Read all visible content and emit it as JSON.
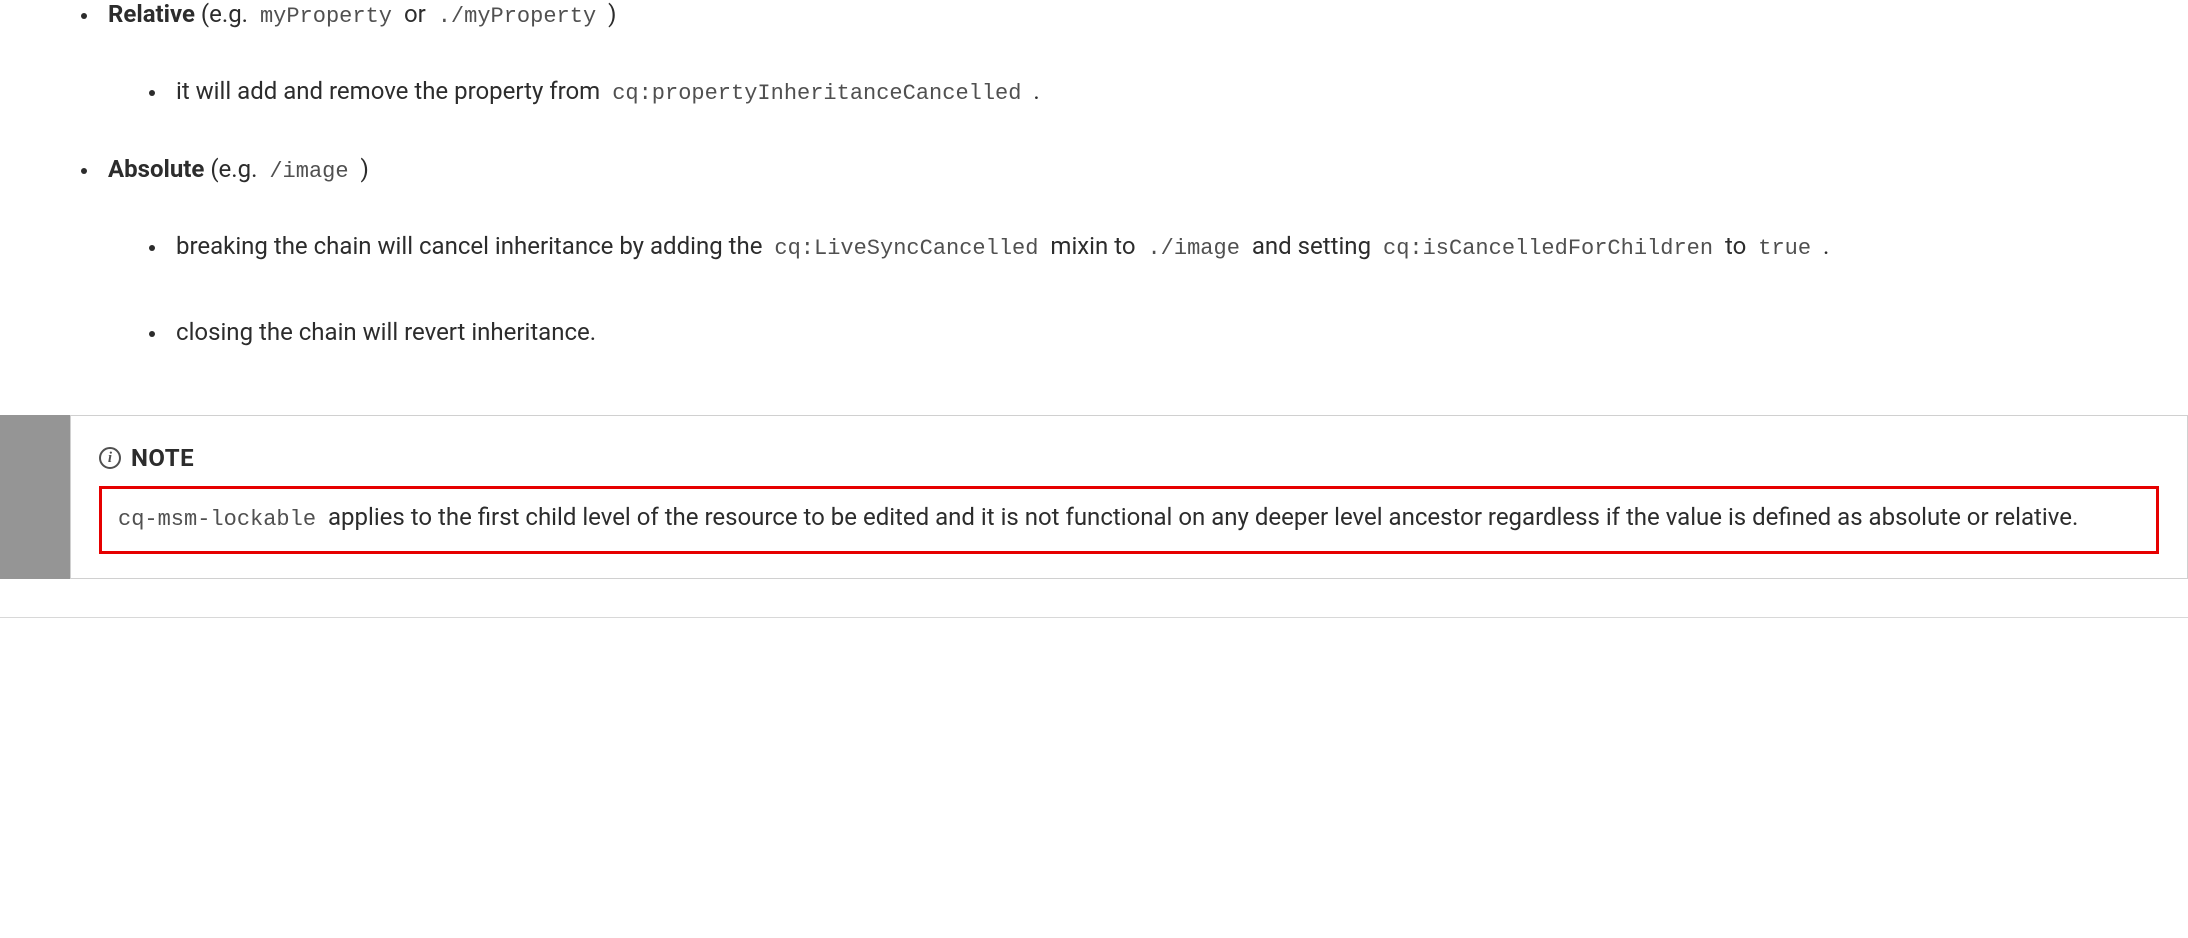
{
  "bullets": {
    "relative": {
      "label": "Relative",
      "eg": "(e.g. ",
      "code1": "myProperty",
      "or": " or ",
      "code2": "./myProperty",
      "close": " )",
      "sub1_prefix": "it will add and remove the property from ",
      "sub1_code": "cq:propertyInheritanceCancelled",
      "sub1_suffix": " ."
    },
    "absolute": {
      "label": "Absolute",
      "eg": "(e.g. ",
      "code1": "/image",
      "close": " )",
      "sub1_prefix": "breaking the chain will cancel inheritance by adding the ",
      "sub1_code1": "cq:LiveSyncCancelled",
      "sub1_mid1": " mixin to ",
      "sub1_code2": "./image",
      "sub1_mid2": " and setting ",
      "sub1_code3": "cq:isCancelledForChildren",
      "sub1_mid3": " to ",
      "sub1_code4": "true",
      "sub1_suffix": " .",
      "sub2": "closing the chain will revert inheritance."
    }
  },
  "note": {
    "label": "NOTE",
    "body_code": "cq-msm-lockable",
    "body_text": " applies to the first child level of the resource to be edited and it is not functional on any deeper level ancestor regardless if the value is defined as absolute or relative."
  }
}
